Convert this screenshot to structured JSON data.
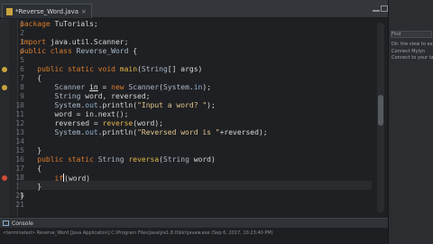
{
  "editor": {
    "tab_label": "*Reverse_Word.java",
    "tab_close": "×",
    "lines": [
      {
        "n": "1",
        "tokens": [
          [
            "kw",
            "package"
          ],
          [
            "plain",
            " TuTorials;"
          ]
        ]
      },
      {
        "n": "2",
        "tokens": []
      },
      {
        "n": "3",
        "tokens": [
          [
            "kw",
            "import"
          ],
          [
            "plain",
            " java.util.Scanner;"
          ]
        ]
      },
      {
        "n": "4",
        "tokens": [
          [
            "kw",
            "public class"
          ],
          [
            "plain",
            " "
          ],
          [
            "type",
            "Reverse_Word"
          ],
          [
            "plain",
            " {"
          ]
        ]
      },
      {
        "n": "5",
        "tokens": []
      },
      {
        "n": "6",
        "tokens": [
          [
            "plain",
            "    "
          ],
          [
            "kw",
            "public static void"
          ],
          [
            "plain",
            " "
          ],
          [
            "fn",
            "main"
          ],
          [
            "plain",
            "("
          ],
          [
            "type",
            "String"
          ],
          [
            "plain",
            "[] args)"
          ]
        ]
      },
      {
        "n": "7",
        "tokens": [
          [
            "plain",
            "    {"
          ]
        ]
      },
      {
        "n": "8",
        "tokens": [
          [
            "plain",
            "        "
          ],
          [
            "type",
            "Scanner"
          ],
          [
            "plain",
            " "
          ],
          [
            "var",
            "in"
          ],
          [
            "plain",
            " = "
          ],
          [
            "kw",
            "new"
          ],
          [
            "plain",
            " "
          ],
          [
            "type",
            "Scanner"
          ],
          [
            "plain",
            "("
          ],
          [
            "type",
            "System"
          ],
          [
            "plain",
            "."
          ],
          [
            "field",
            "in"
          ],
          [
            "plain",
            ");"
          ]
        ]
      },
      {
        "n": "9",
        "tokens": [
          [
            "plain",
            "        "
          ],
          [
            "type",
            "String"
          ],
          [
            "plain",
            " word, reversed;"
          ]
        ]
      },
      {
        "n": "10",
        "tokens": [
          [
            "plain",
            "        "
          ],
          [
            "type",
            "System"
          ],
          [
            "plain",
            "."
          ],
          [
            "field",
            "out"
          ],
          [
            "plain",
            ".println("
          ],
          [
            "str",
            "\"Input a word? \""
          ],
          [
            "plain",
            ");"
          ]
        ]
      },
      {
        "n": "11",
        "tokens": [
          [
            "plain",
            "        word = in.next();"
          ]
        ]
      },
      {
        "n": "12",
        "tokens": [
          [
            "plain",
            "        reversed = "
          ],
          [
            "fn",
            "reverse"
          ],
          [
            "plain",
            "(word);"
          ]
        ]
      },
      {
        "n": "13",
        "tokens": [
          [
            "plain",
            "        "
          ],
          [
            "type",
            "System"
          ],
          [
            "plain",
            "."
          ],
          [
            "field",
            "out"
          ],
          [
            "plain",
            ".println("
          ],
          [
            "str",
            "\"Reversed word is \""
          ],
          [
            "plain",
            "+reversed);"
          ]
        ]
      },
      {
        "n": "14",
        "tokens": []
      },
      {
        "n": "15",
        "tokens": [
          [
            "plain",
            "    }"
          ]
        ]
      },
      {
        "n": "16",
        "tokens": [
          [
            "plain",
            "    "
          ],
          [
            "kw",
            "public static"
          ],
          [
            "plain",
            " "
          ],
          [
            "type",
            "String"
          ],
          [
            "plain",
            " "
          ],
          [
            "fn",
            "reversa"
          ],
          [
            "plain",
            "("
          ],
          [
            "type",
            "String"
          ],
          [
            "plain",
            " word)"
          ]
        ]
      },
      {
        "n": "17",
        "tokens": [
          [
            "plain",
            "    {"
          ]
        ]
      },
      {
        "n": "18",
        "tokens": [
          [
            "plain",
            "        "
          ],
          [
            "kw",
            "if"
          ],
          [
            "caret",
            ""
          ],
          [
            "plain",
            "(word)"
          ]
        ]
      },
      {
        "n": "19",
        "tokens": [
          [
            "plain",
            "    }"
          ]
        ]
      },
      {
        "n": "20",
        "tokens": [
          [
            "plain",
            "}"
          ]
        ]
      },
      {
        "n": "21",
        "tokens": []
      }
    ],
    "markers": {
      "6": "#c9a43d",
      "8": "#c9a43d",
      "18": "#d24a3a"
    }
  },
  "right_panel": {
    "lines": [
      "Find",
      "Dir. the view to extend",
      "Connect Mylyn",
      "Connect to your task and ALM tools or create a local task."
    ]
  },
  "console": {
    "tab_label": "Console",
    "status_text": "<terminated> Reverse_Word [Java Application] C:\\Program Files\\Java\\jre1.8.0\\bin\\javaw.exe (Sep 6, 2017, 10:23:40 PM)"
  }
}
